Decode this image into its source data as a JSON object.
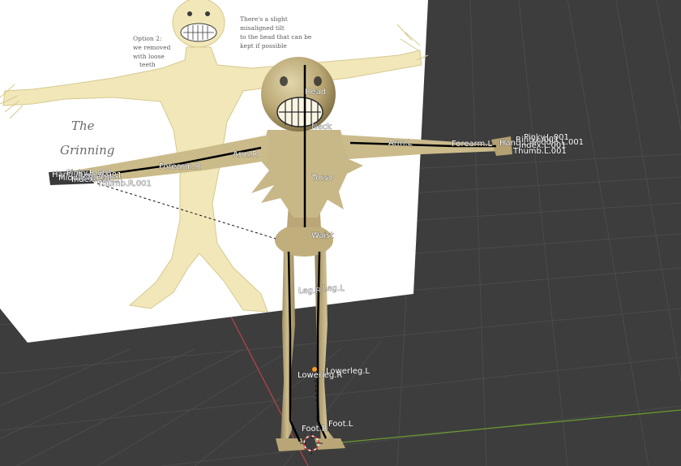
{
  "reference_sheet": {
    "title_lines": [
      "The",
      "Grinning"
    ],
    "note_left_lines": [
      "Option 2:",
      "we removed",
      "with loose",
      "teeth"
    ],
    "note_right_lines": [
      "There's a slight",
      "misaligned tilt",
      "to the head that can be",
      "kept if possible"
    ]
  },
  "bones": {
    "head": "Head",
    "neck": "Neck",
    "torso": "Torso",
    "waist": "Waist",
    "arm_l": "Arm.L",
    "arm_r": "Arm.R",
    "forearm_l": "Forearm.L",
    "forearm_r": "Forearm.R",
    "hand_l": "Hand.L",
    "hand_r": "Hand.R",
    "pinky_l": "Pinky.L.001",
    "ring_l": "Ring.L.001",
    "middle_l": "Middle.L.001",
    "index_l": "Index.L.001",
    "thumb_l": "Thumb.L.001",
    "pinky_r": "Pinky.R.001",
    "ring_r": "Ring.R.001",
    "middle_r": "Middle.R.001",
    "index_r": "Index.R.001",
    "thumb_r": "Thumb.R.001",
    "leg_r": "Leg.R",
    "leg_l": "Leg.L",
    "lowerleg_r": "Lowerleg.R",
    "lowerleg_l": "Lowerleg.L",
    "foot_r": "Foot.R",
    "foot_l": "Foot.L"
  },
  "colors": {
    "viewport_bg": "#3d3d3d",
    "grid": "#4a4a4a",
    "axis_x": "#b2434a",
    "axis_y": "#6a9a2c",
    "sheet": "#ffffff",
    "sketch": "#f1e7b9",
    "model": "#c8b787",
    "bone": "#000000"
  }
}
